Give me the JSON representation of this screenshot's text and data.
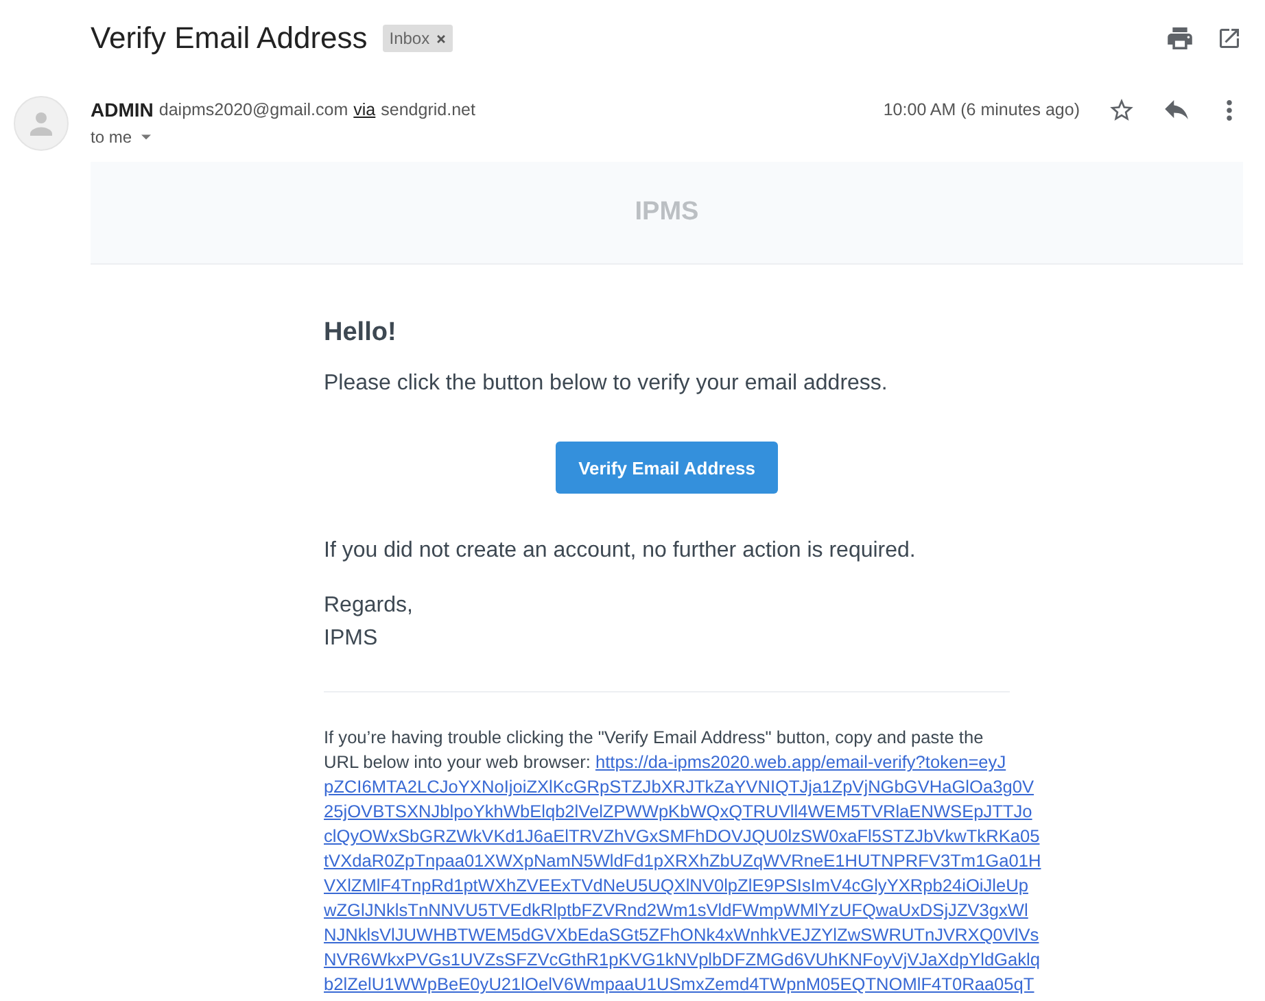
{
  "thread": {
    "subject": "Verify Email Address",
    "labels": [
      {
        "name": "Inbox"
      }
    ]
  },
  "message": {
    "sender_name": "ADMIN",
    "sender_email": "daipms2020@gmail.com",
    "via_label": "via",
    "via_domain": "sendgrid.net",
    "recipient": "to me",
    "time": "10:00 AM (6 minutes ago)",
    "starred": false
  },
  "email_body": {
    "brand": "IPMS",
    "greeting": "Hello!",
    "intro": "Please click the button below to verify your email address.",
    "button": "Verify Email Address",
    "outro": "If you did not create an account, no further action is required.",
    "salutation": "Regards,",
    "signature": "IPMS",
    "help_text": "If you’re having trouble clicking the \"Verify Email Address\" button, copy and paste the URL below into your web browser:",
    "link_lines": [
      "https://da-ipms2020.web.app/email-verify?token=eyJ",
      "pZCI6MTA2LCJoYXNoIjoiZXlKcGRpSTZJbXRJTkZaYVNIQTJja1ZpVjNGbGVHaGlOa3g0V",
      "25jOVBTSXNJblpoYkhWbElqb2lVelZPWWpKbWQxQTRUVll4WEM5TVRlaENWSEpJTTJo",
      "clQyOWxSbGRZWkVKd1J6aElTRVZhVGxSMFhDOVJQU0lzSW0xaFl5STZJbVkwTkRKa05",
      "tVXdaR0ZpTnpaa01XWXpNamN5WldFd1pXRXhZbUZqWVRneE1HUTNPRFV3Tm1Ga01H",
      "VXlZMlF4TnpRd1ptWXhZVEExTVdNeU5UQXlNV0lpZlE9PSIsImV4cGlyYXRpb24iOiJleUp",
      "wZGlJNklsTnNNVU5TVEdkRlptbFZVRnd2Wm1sVldFWmpWMlYzUFQwaUxDSjJZV3gxWl",
      "NJNklsVlJUWHBTWEM5dGVXbEdaSGt5ZFhONk4xWnhkVEJZYlZwSWRUTnJVRXQ0VlVs",
      "NVR6WkxPVGs1UVZsSFZVcGthR1pKVG1kNVplbDFZMGd6VUhKNFoyVjVJaXdpYldGaklq",
      "b2lZelU1WWpBeE0yU21lOelV6WmpaaU1USmxZemd4TWpnM05EQTNOMlF4T0Raa05qT"
    ]
  }
}
